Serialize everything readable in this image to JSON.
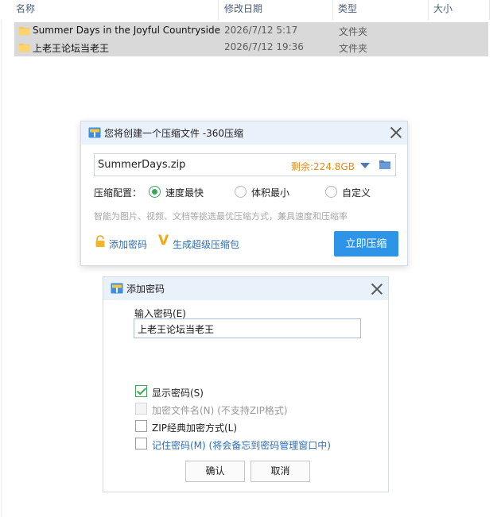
{
  "explorer": {
    "columns": [
      "名称",
      "修改日期",
      "类型",
      "大小"
    ],
    "rows": [
      {
        "name": "Summer Days in the Joyful Countryside",
        "date": "2026/7/12 5:17",
        "type": "文件夹"
      },
      {
        "name": "上老王论坛当老王",
        "date": "2026/7/12 19:36",
        "type": "文件夹"
      }
    ]
  },
  "compress_dialog": {
    "title": "您将创建一个压缩文件 -360压缩",
    "filename": "SummerDays.zip",
    "free_space": "剩余:224.8GB",
    "config_label": "压缩配置：",
    "options": [
      "速度最快",
      "体积最小",
      "自定义"
    ],
    "selected_option": "速度最快",
    "hint": "智能为图片、视频、文档等挑选最优压缩方式，兼具速度和压缩率",
    "add_password_link": "添加密码",
    "super_pack_link": "生成超级压缩包",
    "compress_button": "立即压缩"
  },
  "password_dialog": {
    "title": "添加密码",
    "input_label": "输入密码(E)",
    "password_value": "上老王论坛当老王",
    "checkboxes": [
      {
        "label": "显示密码(S)",
        "checked": true,
        "enabled": true
      },
      {
        "label": "加密文件名(N) (不支持ZIP格式)",
        "checked": false,
        "enabled": false
      },
      {
        "label": "ZIP经典加密方式(L)",
        "checked": false,
        "enabled": true
      },
      {
        "label": "记住密码(M) (将会备忘到密码管理窗口中)",
        "checked": false,
        "enabled": true
      }
    ],
    "ok_button": "确认",
    "cancel_button": "取消"
  },
  "colors": {
    "accent": "#2d94e8",
    "radio_selected": "#3aa757",
    "free_space": "#e98a13",
    "link": "#2d6db5",
    "titlebar": "#e9f1fb",
    "row_selected": "#d9d9d9"
  }
}
